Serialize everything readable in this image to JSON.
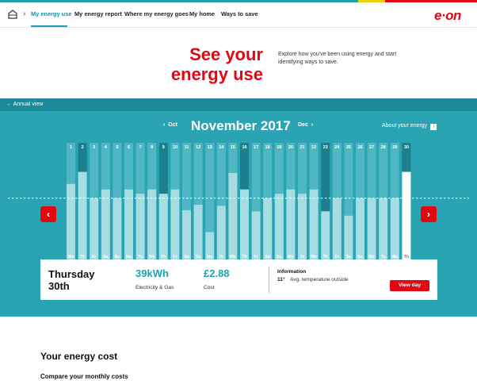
{
  "nav": {
    "items": [
      "My energy use",
      "My energy report",
      "Where my energy goes",
      "My home",
      "Ways to save"
    ],
    "active_index": 0,
    "separator": "›",
    "logo": "e·on",
    "home_icon": "home-icon"
  },
  "hero": {
    "title": "See your energy use",
    "description": "Explore how you've been using energy and start identifying ways to save."
  },
  "calendar": {
    "back_label": "Annual view",
    "prev_month": "Oct",
    "month": "November 2017",
    "next_month": "Dec",
    "about_label": "About your energy",
    "about_icon_text": "i"
  },
  "chart_data": {
    "type": "bar",
    "categories": [
      "1",
      "2",
      "3",
      "4",
      "5",
      "6",
      "7",
      "8",
      "9",
      "10",
      "11",
      "12",
      "13",
      "14",
      "15",
      "16",
      "17",
      "18",
      "19",
      "20",
      "21",
      "22",
      "23",
      "24",
      "25",
      "26",
      "27",
      "28",
      "29",
      "30"
    ],
    "weekdays": [
      "We",
      "Th",
      "Fr",
      "Sa",
      "Su",
      "Mo",
      "Tu",
      "We",
      "Th",
      "Fr",
      "Sa",
      "Su",
      "Mo",
      "Tu",
      "We",
      "Th",
      "Fr",
      "Sa",
      "Su",
      "Mo",
      "Tu",
      "We",
      "Th",
      "Fr",
      "Sa",
      "Su",
      "Mo",
      "Tu",
      "We",
      "Th"
    ],
    "values": [
      0.69,
      0.8,
      0.56,
      0.64,
      0.56,
      0.64,
      0.6,
      0.64,
      0.6,
      0.64,
      0.45,
      0.5,
      0.25,
      0.49,
      0.79,
      0.64,
      0.44,
      0.56,
      0.6,
      0.64,
      0.6,
      0.64,
      0.44,
      0.56,
      0.4,
      0.56,
      0.56,
      0.56,
      0.56,
      0.8
    ],
    "average_line": 0.56,
    "selected_index": 29,
    "highlight_days": [
      2,
      9,
      16,
      23,
      30
    ],
    "colors": {
      "bar": "#a6dde2",
      "selected": "#ffffff",
      "track": "#4fb6c3",
      "track_highlight": "#1d7f8e",
      "day_text": "#ffffff"
    }
  },
  "selected_day": {
    "day_label": "Thursday 30th",
    "usage": "39kWh",
    "usage_label": "Electricity & Gas",
    "cost": "£2.88",
    "cost_label": "Cost",
    "info_heading": "Information",
    "temperature": "11°",
    "temperature_label": "Avg. temperature outside",
    "view_button": "View day"
  },
  "nav_arrows": {
    "left": "‹",
    "right": "›"
  },
  "bottom": {
    "title": "Your energy cost",
    "subtitle": "Compare your monthly costs"
  }
}
